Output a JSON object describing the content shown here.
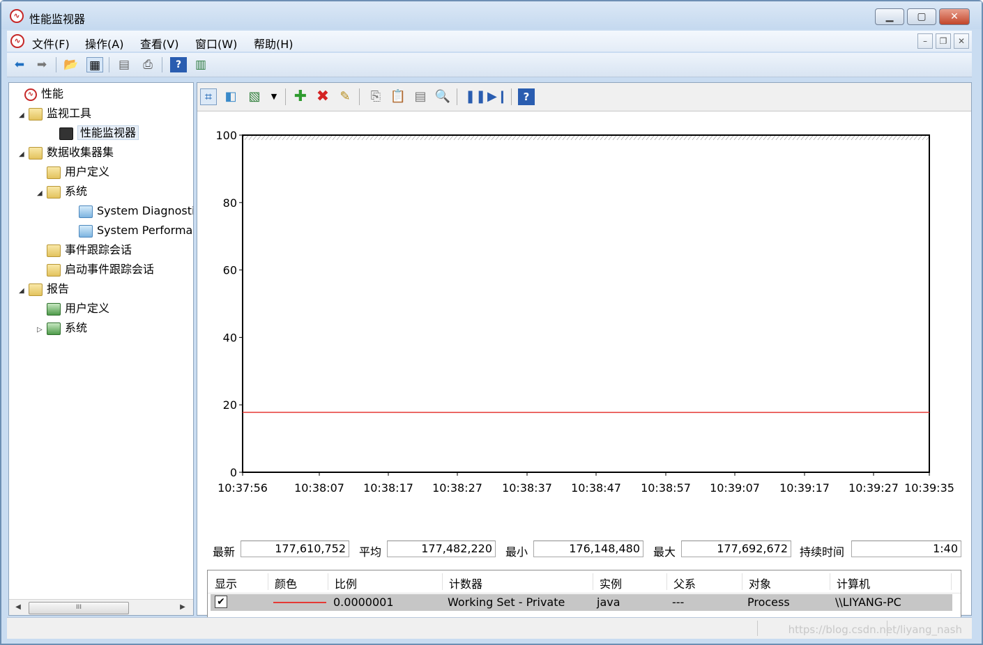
{
  "window": {
    "title": "性能监视器"
  },
  "menu": [
    "文件(F)",
    "操作(A)",
    "查看(V)",
    "窗口(W)",
    "帮助(H)"
  ],
  "tree": [
    {
      "label": "性能",
      "icon": "performance-icon",
      "arrow": ""
    },
    {
      "label": "监视工具",
      "icon": "folder-icon",
      "arrow": "◢"
    },
    {
      "label": "性能监视器",
      "icon": "monitor-icon",
      "arrow": ""
    },
    {
      "label": "数据收集器集",
      "icon": "folder-icon",
      "arrow": "◢"
    },
    {
      "label": "用户定义",
      "icon": "folder-user-icon",
      "arrow": ""
    },
    {
      "label": "系统",
      "icon": "folder-system-icon",
      "arrow": "◢"
    },
    {
      "label": "System Diagnostics",
      "icon": "data-collector-icon",
      "arrow": ""
    },
    {
      "label": "System Performance",
      "icon": "data-collector-icon",
      "arrow": ""
    },
    {
      "label": "事件跟踪会话",
      "icon": "folder-trace-icon",
      "arrow": ""
    },
    {
      "label": "启动事件跟踪会话",
      "icon": "folder-trace-icon",
      "arrow": ""
    },
    {
      "label": "报告",
      "icon": "folder-report-icon",
      "arrow": "◢"
    },
    {
      "label": "用户定义",
      "icon": "report-icon",
      "arrow": ""
    },
    {
      "label": "系统",
      "icon": "report-icon",
      "arrow": "▷"
    }
  ],
  "tree_scroll_thumb": "III",
  "stats": {
    "last_label": "最新",
    "last": "177,610,752",
    "avg_label": "平均",
    "avg": "177,482,220",
    "min_label": "最小",
    "min": "176,148,480",
    "max_label": "最大",
    "max": "177,692,672",
    "duration_label": "持续时间",
    "duration": "1:40"
  },
  "table": {
    "headers": [
      "显示",
      "颜色",
      "比例",
      "计数器",
      "实例",
      "父系",
      "对象",
      "计算机"
    ],
    "row": {
      "checked": "✔",
      "scale": "0.0000001",
      "counter": "Working Set - Private",
      "instance": "java",
      "parent": "---",
      "object": "Process",
      "computer": "\\\\LIYANG-PC",
      "line_color": "#e53935"
    }
  },
  "chart_data": {
    "type": "line",
    "x": [
      "10:37:56",
      "10:38:07",
      "10:38:17",
      "10:38:27",
      "10:38:37",
      "10:38:47",
      "10:38:57",
      "10:39:07",
      "10:39:17",
      "10:39:27",
      "10:39:35"
    ],
    "series": [
      {
        "values": [
          17.76,
          17.76,
          17.76,
          17.74,
          17.74,
          17.75,
          17.75,
          17.75,
          17.75,
          17.75,
          17.76
        ],
        "color": "#e53935"
      }
    ],
    "yticks": [
      "100",
      "80",
      "60",
      "40",
      "20",
      "0"
    ],
    "ylim": [
      0,
      100
    ],
    "grid": false
  },
  "watermark": "https://blog.csdn.net/liyang_nash"
}
